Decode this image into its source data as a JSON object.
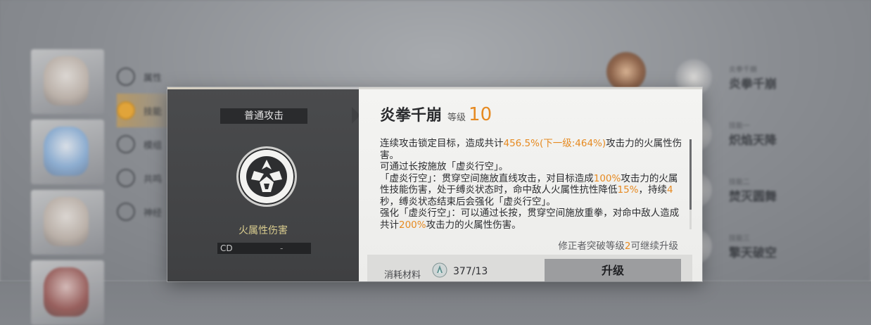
{
  "background": {
    "menu": [
      "属性",
      "技能",
      "模组",
      "共鸣",
      "神经"
    ],
    "right_list": [
      {
        "sub": "炎拳千崩",
        "name": "炎拳千崩"
      },
      {
        "sub": "技能一",
        "name": "炽焰天降"
      },
      {
        "sub": "技能二",
        "name": "焚灭圆舞"
      },
      {
        "sub": "技能三",
        "name": "擎天破空"
      }
    ]
  },
  "skill_panel": {
    "attack_type": "普通攻击",
    "emblem_icon": "flame-fist-icon",
    "damage_type": "火属性伤害",
    "cd_label": "CD",
    "cd_value": "-"
  },
  "skill_detail": {
    "name": "炎拳千崩",
    "level_label": "等级",
    "level_value": "10",
    "description": [
      {
        "t": "连续攻击锁定目标，造成共计"
      },
      {
        "t": "456.5%(下一级:464%)",
        "hl": true
      },
      {
        "t": "攻击力的火属性伤害。"
      },
      {
        "br": true
      },
      {
        "t": "可通过长按施放「虚炎行空」。"
      },
      {
        "br": true
      },
      {
        "t": "「虚炎行空」：贯穿空间施放直线攻击，对目标造成"
      },
      {
        "t": "100%",
        "hl": true
      },
      {
        "t": "攻击力的火属性技能伤害，处于缚炎状态时，命中敌人火属性抗性降低"
      },
      {
        "t": "15%",
        "hl": true
      },
      {
        "t": "，持续"
      },
      {
        "t": "4",
        "hl": true
      },
      {
        "t": "秒，缚炎状态结束后会强化「虚炎行空」。"
      },
      {
        "br": true
      },
      {
        "t": "强化「虚炎行空」：可以通过长按，贯穿空间施放重拳，对命中敌人造成共计"
      },
      {
        "t": "200%",
        "hl": true
      },
      {
        "t": "攻击力的火属性伤害。"
      }
    ],
    "hint_prefix": "修正者突破等级",
    "hint_level": "2",
    "hint_suffix": "可继续升级",
    "cost_label": "消耗材料",
    "material_icon": "crystal-material-icon",
    "cost_count": "377/13",
    "upgrade_label": "升级"
  },
  "colors": {
    "accent": "#e68a21",
    "panel_dark": "#404143",
    "panel_light": "#f2f2f0",
    "damage_text": "#d9cc8e"
  }
}
